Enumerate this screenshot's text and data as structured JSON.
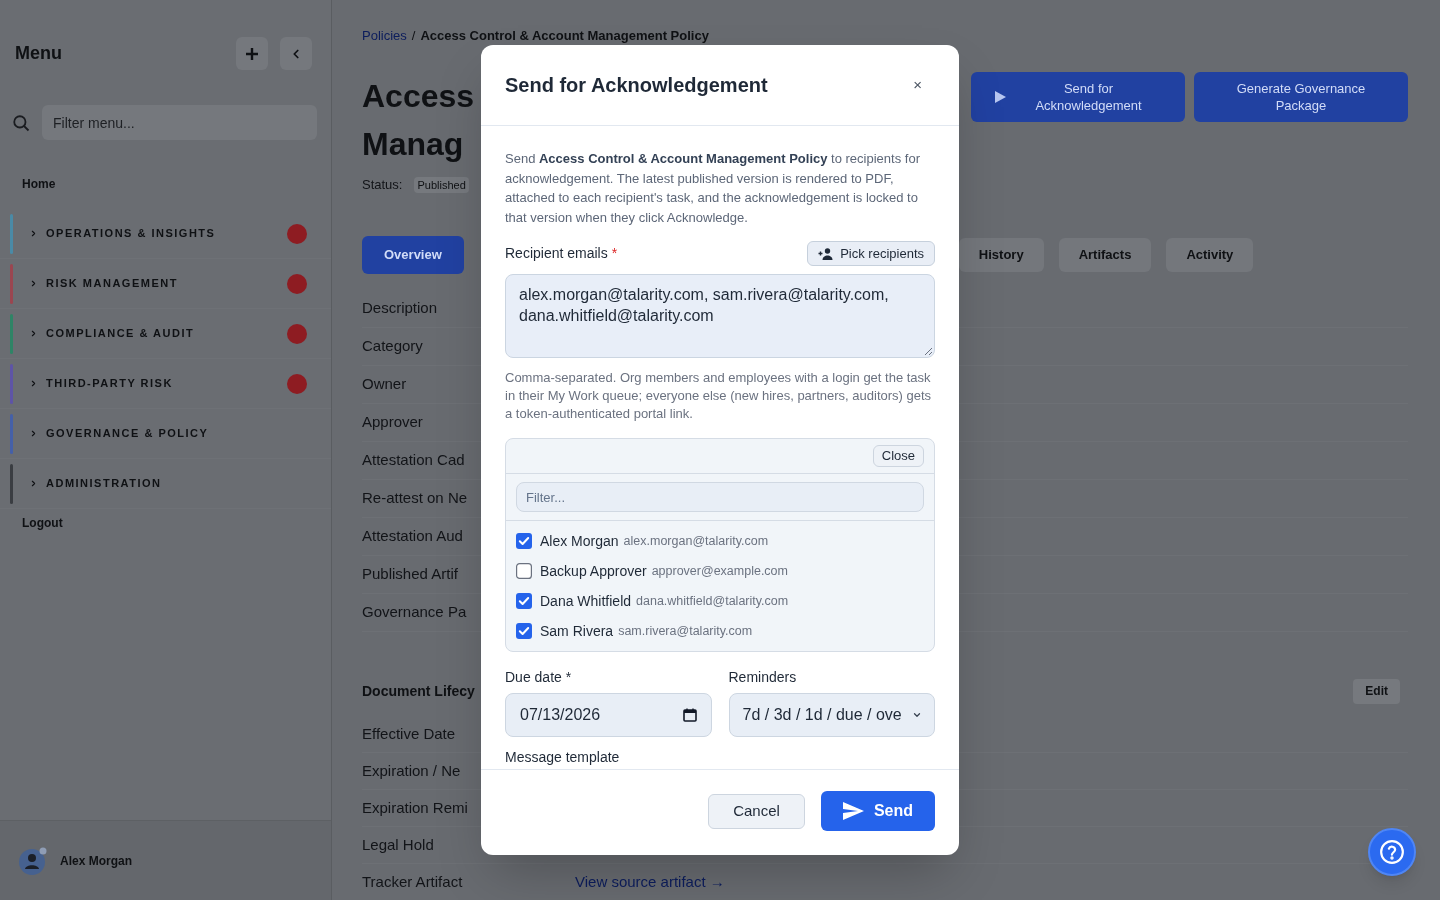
{
  "sidebar": {
    "title": "Menu",
    "filter": {
      "placeholder": "Filter menu..."
    },
    "home": "Home",
    "groups": [
      {
        "label": "OPERATIONS & INSIGHTS",
        "color": "#4a8aa6",
        "badge": true
      },
      {
        "label": "RISK MANAGEMENT",
        "color": "#9a4650",
        "badge": true
      },
      {
        "label": "COMPLIANCE & AUDIT",
        "color": "#2f8466",
        "badge": true
      },
      {
        "label": "THIRD-PARTY RISK",
        "color": "#5e54a6",
        "badge": true
      },
      {
        "label": "GOVERNANCE & POLICY",
        "color": "#4560a8",
        "badge": false
      },
      {
        "label": "ADMINISTRATION",
        "color": "#3a3d42",
        "badge": false
      }
    ],
    "logout": "Logout",
    "user": {
      "name": "Alex Morgan"
    }
  },
  "page": {
    "breadcrumb": {
      "link": "Policies",
      "separator": "/",
      "current": "Access Control & Account Management Policy"
    },
    "title_lines": [
      "Access",
      "Manag"
    ],
    "status": {
      "label": "Status:",
      "value": "Published"
    },
    "actions": [
      {
        "label": "Send for Acknowledgement",
        "kind": "play"
      },
      {
        "label": "Generate Governance Package",
        "kind": "plain"
      }
    ],
    "tabs": [
      {
        "label": "Overview",
        "selected": true
      },
      {
        "label": "History",
        "selected": false
      },
      {
        "label": "Artifacts",
        "selected": false
      },
      {
        "label": "Activity",
        "selected": false
      }
    ],
    "fields": [
      "Description",
      "Category",
      "Owner",
      "Approver",
      "Attestation Cad",
      "Re-attest on Ne",
      "Attestation Aud",
      "Published Artif",
      "Governance Pa"
    ],
    "lifecycle": {
      "heading": "Document Lifecy",
      "edit": "Edit",
      "rows": [
        {
          "label": "Effective Date"
        },
        {
          "label": "Expiration / Ne"
        },
        {
          "label": "Expiration Remi"
        },
        {
          "label": "Legal Hold"
        },
        {
          "label": "Tracker Artifact",
          "link": "View source artifact →"
        }
      ]
    }
  },
  "dialog": {
    "title": "Send for Acknowledgement",
    "close": "×",
    "intro": "Send **Access Control & Account Management Policy** to recipients for acknowledgement. The latest published version is rendered to PDF, attached to each recipient's task, and the acknowledgement is locked to that version when they click Acknowledge.",
    "recipients": {
      "label": "Recipient emails",
      "required_mark": "*",
      "pick_button": "Pick recipients",
      "value": "alex.morgan@talarity.com, sam.rivera@talarity.com, dana.whitfield@talarity.com",
      "hint": "Comma-separated. Org members and employees with a login get the task in their My Work queue; everyone else (new hires, partners, auditors) gets a token-authenticated portal link."
    },
    "picker": {
      "close": "Close",
      "filter": {
        "placeholder": "Filter..."
      },
      "people": [
        {
          "name": "Alex Morgan",
          "email": "alex.morgan@talarity.com",
          "checked": true
        },
        {
          "name": "Backup Approver",
          "email": "approver@example.com",
          "checked": false
        },
        {
          "name": "Dana Whitfield",
          "email": "dana.whitfield@talarity.com",
          "checked": true
        },
        {
          "name": "Sam Rivera",
          "email": "sam.rivera@talarity.com",
          "checked": true
        }
      ]
    },
    "due_date": {
      "label": "Due date *",
      "value": "07/13/2026"
    },
    "reminders": {
      "label": "Reminders",
      "value": "7d / 3d / 1d / due / ove"
    },
    "message_template": {
      "label": "Message template"
    },
    "buttons": [
      {
        "label": "Cancel",
        "kind": "secondary"
      },
      {
        "label": "Send",
        "kind": "primary"
      }
    ]
  }
}
